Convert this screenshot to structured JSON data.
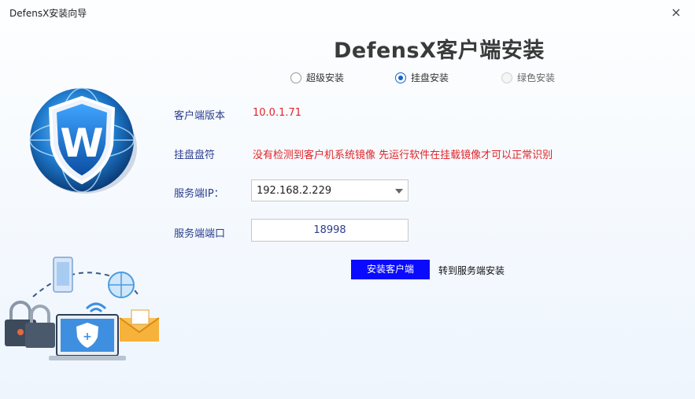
{
  "window": {
    "title": "DefensX安装向导",
    "close_label": "×"
  },
  "heading": "DefensX客户端安装",
  "install_modes": [
    {
      "label": "超级安装",
      "state": "unchecked"
    },
    {
      "label": "挂盘安装",
      "state": "checked"
    },
    {
      "label": "绿色安装",
      "state": "disabled"
    }
  ],
  "form": {
    "version_label": "客户端版本",
    "version_value": "10.0.1.71",
    "disk_label": "挂盘盘符",
    "disk_message": "没有检测到客户机系统镜像 先运行软件在挂载镜像才可以正常识别",
    "server_ip_label": "服务端IP：",
    "server_ip_value": "192.168.2.229",
    "server_port_label": "服务端端口",
    "server_port_value": "18998"
  },
  "actions": {
    "install_label": "安装客户端",
    "switch_label": "转到服务端安装"
  },
  "logo": {
    "letter": "W"
  },
  "colors": {
    "accent": "#0a0aff",
    "label": "#2b3d8f",
    "error": "#e0242a",
    "radio": "#1566c8"
  }
}
